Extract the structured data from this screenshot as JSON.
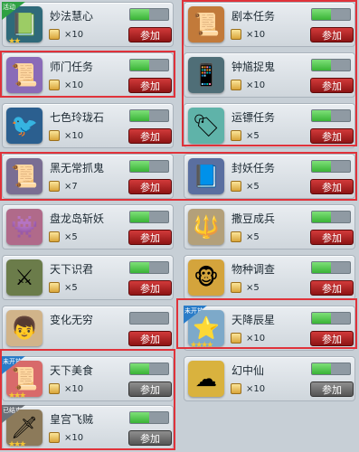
{
  "tasks": [
    {
      "name": "妙法慧心",
      "count": "×10",
      "button": "参加",
      "button_state": "active",
      "progress": 0.5,
      "icon": "book-icon",
      "icon_bg": "#2f6a7a",
      "badge": "",
      "stars": 2
    },
    {
      "name": "剧本任务",
      "count": "×10",
      "button": "参加",
      "button_state": "active",
      "progress": 0.5,
      "icon": "scroll-icon",
      "icon_bg": "#c27a3a",
      "badge": "",
      "stars": 0
    },
    {
      "name": "师门任务",
      "count": "×10",
      "button": "参加",
      "button_state": "active",
      "progress": 0.5,
      "icon": "scroll-icon",
      "icon_bg": "#8a6bb8",
      "badge": "",
      "stars": 0
    },
    {
      "name": "钟馗捉鬼",
      "count": "×10",
      "button": "参加",
      "button_state": "active",
      "progress": 0.5,
      "icon": "phone-icon",
      "icon_bg": "#4f6e77",
      "badge": "",
      "stars": 0
    },
    {
      "name": "七色玲珑石",
      "count": "×10",
      "button": "参加",
      "button_state": "active",
      "progress": 0.5,
      "icon": "bird-icon",
      "icon_bg": "#2b5f8f",
      "badge": "",
      "stars": 0
    },
    {
      "name": "运镖任务",
      "count": "×5",
      "button": "参加",
      "button_state": "active",
      "progress": 0.5,
      "icon": "tag-icon",
      "icon_bg": "#5fb3a9",
      "badge": "",
      "stars": 0
    },
    {
      "name": "黑无常抓鬼",
      "count": "×7",
      "button": "参加",
      "button_state": "active",
      "progress": 0.5,
      "icon": "scroll-icon",
      "icon_bg": "#7a6e93",
      "badge": "",
      "stars": 0
    },
    {
      "name": "封妖任务",
      "count": "×5",
      "button": "参加",
      "button_state": "active",
      "progress": 0.5,
      "icon": "book-icon",
      "icon_bg": "#5a6fa0",
      "badge": "",
      "stars": 0
    },
    {
      "name": "盘龙岛斩妖",
      "count": "×5",
      "button": "参加",
      "button_state": "active",
      "progress": 0.5,
      "icon": "monster-icon",
      "icon_bg": "#b06a8a",
      "badge": "",
      "stars": 0
    },
    {
      "name": "撒豆成兵",
      "count": "×5",
      "button": "参加",
      "button_state": "active",
      "progress": 0.5,
      "icon": "spear-icon",
      "icon_bg": "#b3a07a",
      "badge": "",
      "stars": 0
    },
    {
      "name": "天下识君",
      "count": "×5",
      "button": "参加",
      "button_state": "active",
      "progress": 0.5,
      "icon": "warrior-icon",
      "icon_bg": "#6b7c4a",
      "badge": "",
      "stars": 0
    },
    {
      "name": "物种调查",
      "count": "×5",
      "button": "参加",
      "button_state": "active",
      "progress": 0.5,
      "icon": "creature-icon",
      "icon_bg": "#d4a43c",
      "badge": "",
      "stars": 0
    },
    {
      "name": "变化无穷",
      "count": "",
      "button": "参加",
      "button_state": "active",
      "progress": 0.0,
      "icon": "child-icon",
      "icon_bg": "#d1b48a",
      "badge": "",
      "stars": 0
    },
    {
      "name": "天降辰星",
      "count": "×10",
      "button": "参加",
      "button_state": "active",
      "progress": 0.5,
      "icon": "star-icon",
      "icon_bg": "#7da9c9",
      "badge": "未开放",
      "stars": 4
    },
    {
      "name": "天下美食",
      "count": "×10",
      "button": "参加",
      "button_state": "inactive",
      "progress": 0.5,
      "icon": "scroll-icon",
      "icon_bg": "#d86a6a",
      "badge": "未开放",
      "stars": 3
    },
    {
      "name": "幻中仙",
      "count": "×10",
      "button": "参加",
      "button_state": "inactive",
      "progress": 0.5,
      "icon": "cloud-icon",
      "icon_bg": "#d9b23e",
      "badge": "",
      "stars": 0
    },
    {
      "name": "皇宫飞贼",
      "count": "×10",
      "button": "参加",
      "button_state": "inactive",
      "progress": 0.5,
      "icon": "spear-icon",
      "icon_bg": "#8c7a5a",
      "badge": "已结束",
      "stars": 3
    }
  ],
  "colors": {
    "highlight": "#e0323a",
    "button_active": "#b01e1e",
    "button_inactive": "#6b6b6b",
    "progress": "#4fc94a"
  }
}
